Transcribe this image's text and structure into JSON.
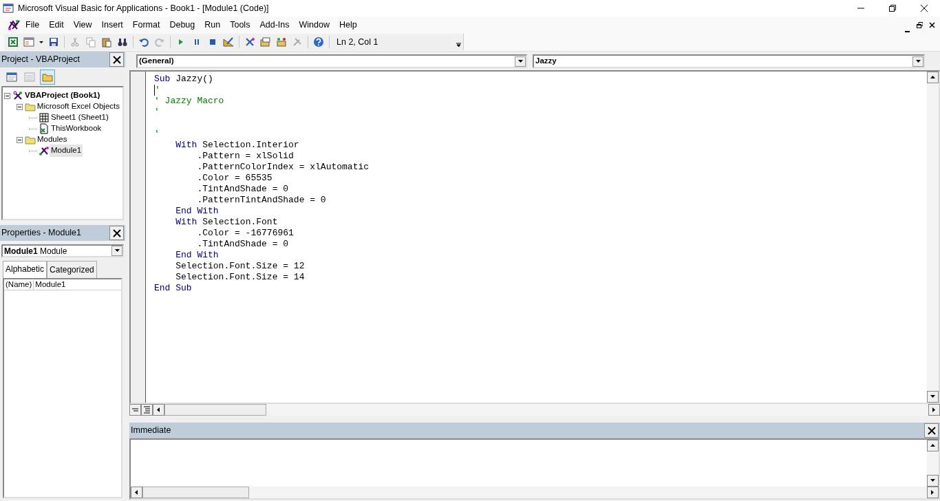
{
  "window": {
    "title": "Microsoft Visual Basic for Applications - Book1 - [Module1 (Code)]"
  },
  "menu": [
    "File",
    "Edit",
    "View",
    "Insert",
    "Format",
    "Debug",
    "Run",
    "Tools",
    "Add-Ins",
    "Window",
    "Help"
  ],
  "toolbar": {
    "position": "Ln 2, Col 1"
  },
  "project_panel": {
    "title": "Project - VBAProject",
    "tree": [
      {
        "label": "VBAProject (Book1)",
        "kind": "project",
        "expanded": true,
        "selected": false,
        "children": [
          {
            "label": "Microsoft Excel Objects",
            "kind": "folder",
            "expanded": true,
            "selected": false,
            "children": [
              {
                "label": "Sheet1 (Sheet1)",
                "kind": "sheet",
                "selected": false
              },
              {
                "label": "ThisWorkbook",
                "kind": "workbook",
                "selected": false
              }
            ]
          },
          {
            "label": "Modules",
            "kind": "folder",
            "expanded": true,
            "selected": false,
            "children": [
              {
                "label": "Module1",
                "kind": "module",
                "selected": true
              }
            ]
          }
        ]
      }
    ]
  },
  "properties_panel": {
    "title": "Properties - Module1",
    "object_name": "Module1",
    "object_type": "Module",
    "tabs": [
      {
        "label": "Alphabetic",
        "selected": true
      },
      {
        "label": "Categorized",
        "selected": false
      }
    ],
    "rows": [
      {
        "name": "(Name)",
        "value": "Module1"
      }
    ]
  },
  "code_window": {
    "object_combo": "(General)",
    "procedure_combo": "Jazzy",
    "lines": [
      {
        "caret": false,
        "segments": [
          {
            "kind": "keyword",
            "text": "Sub"
          },
          {
            "kind": "plain",
            "text": " Jazzy()"
          }
        ]
      },
      {
        "caret": true,
        "segments": [
          {
            "kind": "comment",
            "text": "'"
          }
        ]
      },
      {
        "caret": false,
        "segments": [
          {
            "kind": "comment",
            "text": "' Jazzy Macro"
          }
        ]
      },
      {
        "caret": false,
        "segments": [
          {
            "kind": "comment",
            "text": "'"
          }
        ]
      },
      {
        "caret": false
      },
      {
        "caret": false,
        "segments": [
          {
            "kind": "comment",
            "text": "'"
          }
        ]
      },
      {
        "caret": false,
        "segments": [
          {
            "kind": "keyword",
            "text": "    With"
          },
          {
            "kind": "plain",
            "text": " Selection.Interior"
          }
        ]
      },
      {
        "caret": false,
        "segments": [
          {
            "kind": "plain",
            "text": "        .Pattern = xlSolid"
          }
        ]
      },
      {
        "caret": false,
        "segments": [
          {
            "kind": "plain",
            "text": "        .PatternColorIndex = xlAutomatic"
          }
        ]
      },
      {
        "caret": false,
        "segments": [
          {
            "kind": "plain",
            "text": "        .Color = 65535"
          }
        ]
      },
      {
        "caret": false,
        "segments": [
          {
            "kind": "plain",
            "text": "        .TintAndShade = 0"
          }
        ]
      },
      {
        "caret": false,
        "segments": [
          {
            "kind": "plain",
            "text": "        .PatternTintAndShade = 0"
          }
        ]
      },
      {
        "caret": false,
        "segments": [
          {
            "kind": "keyword",
            "text": "    End With"
          }
        ]
      },
      {
        "caret": false,
        "segments": [
          {
            "kind": "keyword",
            "text": "    With"
          },
          {
            "kind": "plain",
            "text": " Selection.Font"
          }
        ]
      },
      {
        "caret": false,
        "segments": [
          {
            "kind": "plain",
            "text": "        .Color = -16776961"
          }
        ]
      },
      {
        "caret": false,
        "segments": [
          {
            "kind": "plain",
            "text": "        .TintAndShade = 0"
          }
        ]
      },
      {
        "caret": false,
        "segments": [
          {
            "kind": "keyword",
            "text": "    End With"
          }
        ]
      },
      {
        "caret": false,
        "segments": [
          {
            "kind": "plain",
            "text": "    Selection.Font.Size = 12"
          }
        ]
      },
      {
        "caret": false,
        "segments": [
          {
            "kind": "plain",
            "text": "    Selection.Font.Size = 14"
          }
        ]
      },
      {
        "caret": false,
        "segments": [
          {
            "kind": "keyword",
            "text": "End Sub"
          }
        ]
      }
    ]
  },
  "immediate_panel": {
    "title": "Immediate"
  }
}
